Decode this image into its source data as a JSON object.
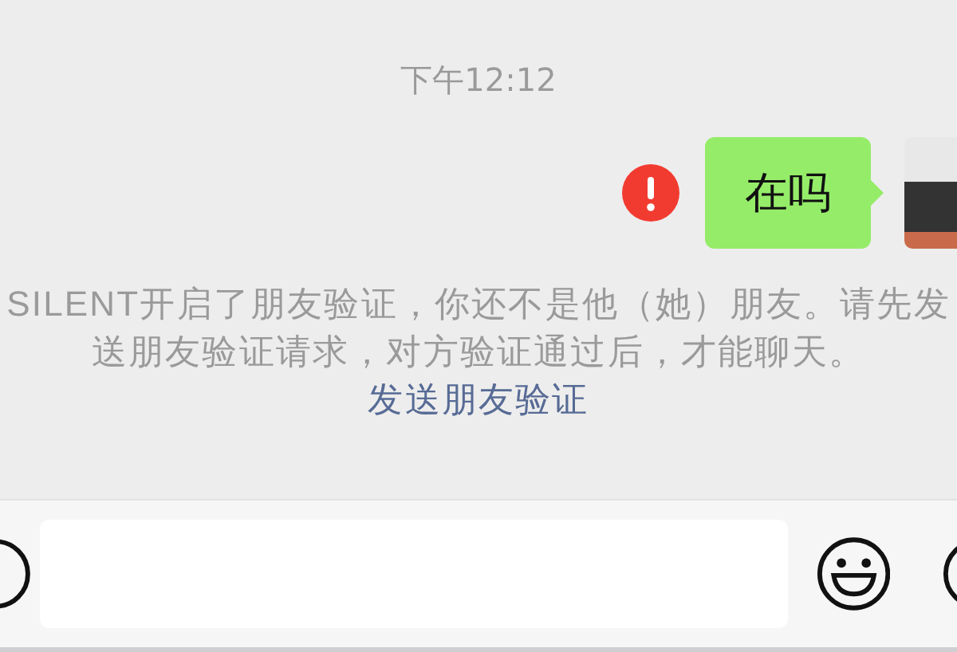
{
  "timestamp": "下午12:12",
  "messages": [
    {
      "text": "在吗",
      "failed": true
    }
  ],
  "notice": {
    "text": "SILENT开启了朋友验证，你还不是他（她）朋友。请先发送朋友验证请求，对方验证通过后，才能聊天。",
    "link": "发送朋友验证"
  }
}
